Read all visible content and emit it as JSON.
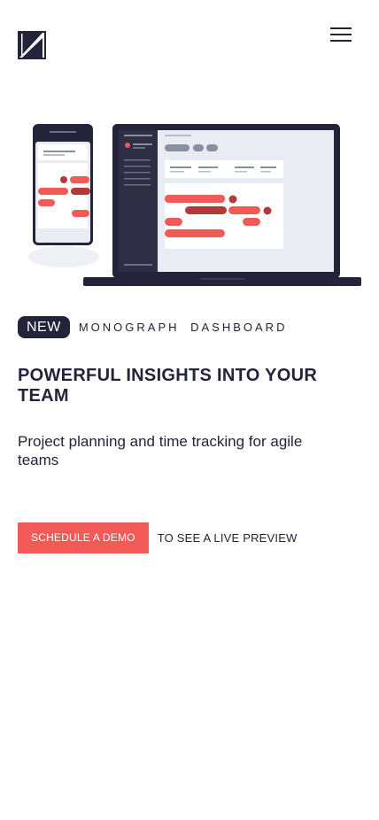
{
  "header": {
    "logo_icon": "k-logo-icon",
    "menu_icon": "hamburger-menu-icon"
  },
  "hero_illustration": {
    "icon": "dashboard-devices-illustration",
    "accent": "#f25a57",
    "dark": "#23233a"
  },
  "tagline": {
    "badge": "NEW",
    "product": "MONOGRAPH  DASHBOARD"
  },
  "headline": "POWERFUL INSIGHTS INTO YOUR TEAM",
  "subhead": "Project planning and time tracking for agile teams",
  "cta": {
    "button_label": "SCHEDULE A DEMO",
    "suffix": "TO SEE A LIVE PREVIEW"
  },
  "colors": {
    "primary": "#23233a",
    "accent": "#f25a57",
    "background": "#ffffff"
  }
}
